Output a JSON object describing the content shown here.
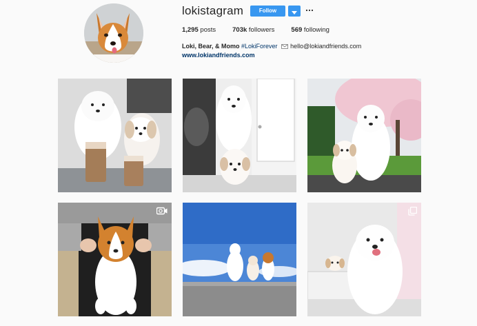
{
  "profile": {
    "username": "lokistagram",
    "follow_label": "Follow",
    "stats": {
      "posts_value": "1,295",
      "posts_label": "posts",
      "followers_value": "703k",
      "followers_label": "followers",
      "following_value": "569",
      "following_label": "following"
    },
    "bio": {
      "name": "Loki, Bear, & Momo",
      "hashtag": "#LokiForever",
      "email": "hello@lokiandfriends.com"
    },
    "website": "www.lokiandfriends.com"
  },
  "posts": [
    {
      "kind": "photo"
    },
    {
      "kind": "photo"
    },
    {
      "kind": "photo"
    },
    {
      "kind": "video",
      "badge_icon": "video-camera-icon"
    },
    {
      "kind": "photo"
    },
    {
      "kind": "carousel",
      "badge_icon": "carousel-icon"
    }
  ],
  "colors": {
    "accent": "#3897f0",
    "link": "#003569",
    "background": "#fafafa"
  }
}
